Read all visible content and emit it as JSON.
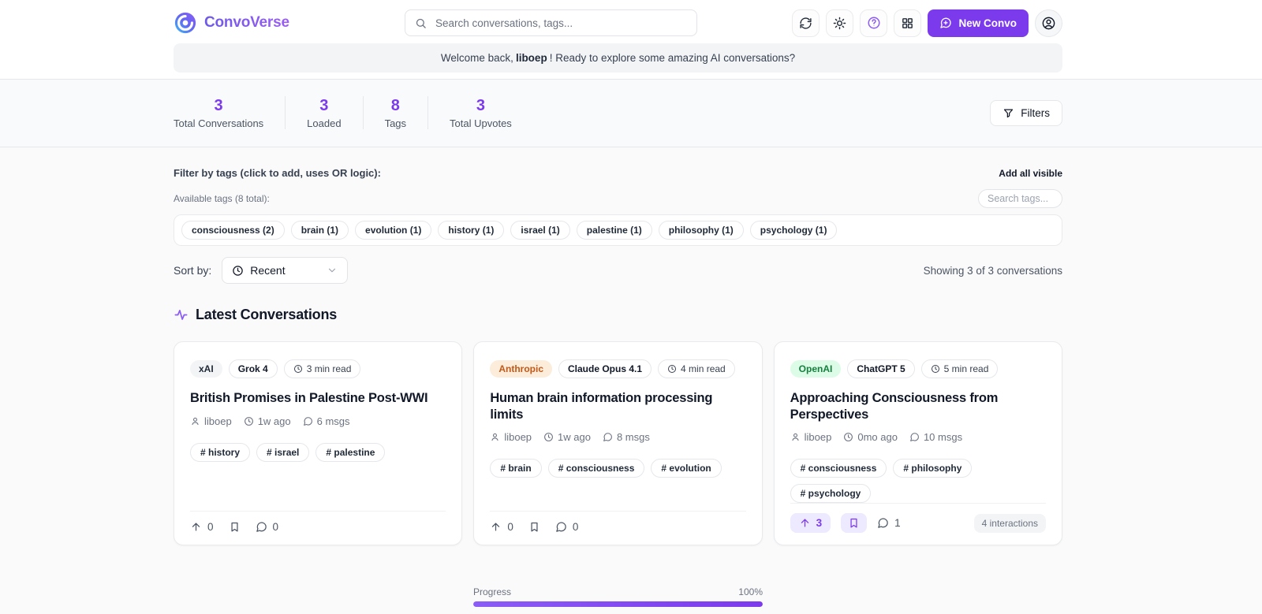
{
  "header": {
    "brand": "ConvoVerse",
    "search_placeholder": "Search conversations, tags...",
    "new_convo_label": "New Convo",
    "welcome": {
      "prefix": "Welcome back,",
      "user": "liboep",
      "suffix": "! Ready to explore some amazing AI conversations?"
    }
  },
  "stats": {
    "items": [
      {
        "value": "3",
        "label": "Total Conversations"
      },
      {
        "value": "3",
        "label": "Loaded"
      },
      {
        "value": "8",
        "label": "Tags"
      },
      {
        "value": "3",
        "label": "Total Upvotes"
      }
    ],
    "filters_label": "Filters"
  },
  "tag_filter": {
    "title": "Filter by tags (click to add, uses OR logic):",
    "add_all_label": "Add all visible",
    "available_label": "Available tags (8 total):",
    "search_placeholder": "Search tags...",
    "tags": [
      "consciousness (2)",
      "brain (1)",
      "evolution (1)",
      "history (1)",
      "israel (1)",
      "palestine (1)",
      "philosophy (1)",
      "psychology (1)"
    ]
  },
  "sort": {
    "label": "Sort by:",
    "selected": "Recent",
    "showing": "Showing 3 of 3 conversations"
  },
  "section": {
    "title": "Latest Conversations"
  },
  "cards": [
    {
      "provider": "xAI",
      "model": "Grok 4",
      "read_time": "3 min read",
      "title": "British Promises in Palestine Post-WWI",
      "author": "liboep",
      "age": "1w ago",
      "msgs": "6 msgs",
      "tags": [
        "# history",
        "# israel",
        "# palestine"
      ],
      "upvotes": "0",
      "comments": "0"
    },
    {
      "provider": "Anthropic",
      "model": "Claude Opus 4.1",
      "read_time": "4 min read",
      "title": "Human brain information processing limits",
      "author": "liboep",
      "age": "1w ago",
      "msgs": "8 msgs",
      "tags": [
        "# brain",
        "# consciousness",
        "# evolution"
      ],
      "upvotes": "0",
      "comments": "0"
    },
    {
      "provider": "OpenAI",
      "model": "ChatGPT 5",
      "read_time": "5 min read",
      "title": "Approaching Consciousness from Perspectives",
      "author": "liboep",
      "age": "0mo ago",
      "msgs": "10 msgs",
      "tags": [
        "# consciousness",
        "# philosophy",
        "# psychology"
      ],
      "upvotes": "3",
      "comments": "1",
      "interactions": "4 interactions"
    }
  ],
  "progress": {
    "label": "Progress",
    "value": "100%",
    "percent": 100
  },
  "colors": {
    "accent": "#7c3aed",
    "anthropic_badge_text": "#c05a1a",
    "openai_badge_text": "#15803d",
    "stat_number": "#7c3aed"
  }
}
